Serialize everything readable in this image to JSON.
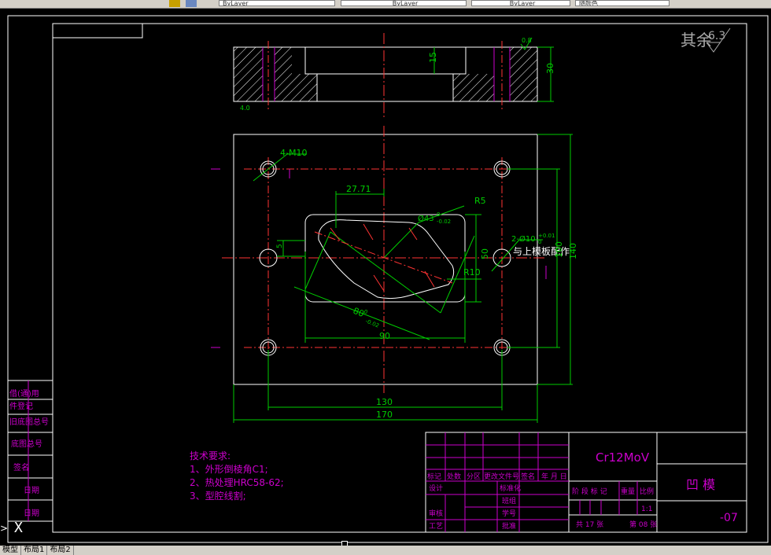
{
  "toolbar": {
    "layer_combo_1": "ByLayer",
    "layer_combo_2": "ByLayer",
    "layer_combo_3": "ByLayer",
    "plot_style": "随颜色"
  },
  "drawing": {
    "surface_finish_label": "其余",
    "surface_finish_value": "6.3",
    "top_finish": "0.8",
    "top_view_small_label": "4.0",
    "dim_15": "15",
    "dim_30": "30",
    "dim_4m10": "4-M10",
    "dim_27_71": "27.71",
    "dim_r5": "R5",
    "dim_phi43": "Ø43",
    "dim_phi43_tol": "-0.02",
    "dim_phi43_tol_up": "0",
    "dim_2phi10": "2-Ø10",
    "dim_2phi10_tol": "+0.01",
    "dim_2phi10_tol_low": "0",
    "note_match": "与上模板配作",
    "dim_5": "5",
    "dim_50": "50",
    "dim_r10": "R10",
    "dim_80": "80",
    "dim_80_tol": "-0.02",
    "dim_80_tol_up": "0",
    "dim_90": "90",
    "dim_100": "100",
    "dim_140": "140",
    "dim_130": "130",
    "dim_170": "170"
  },
  "tech_requirements": {
    "title": "技术要求:",
    "item1": "1、外形倒棱角C1;",
    "item2": "2、热处理HRC58-62;",
    "item3": "3、型腔线割;"
  },
  "side_table": {
    "r1": "借(通)用",
    "r2": "件登记",
    "r3": "旧底图总号",
    "r4": "底图总号",
    "r5": "签名",
    "r6": "日期",
    "r7": "日期"
  },
  "title_block": {
    "material": "Cr12MoV",
    "part_name": "凹  模",
    "drawing_no": "-07",
    "h_biaoji": "标记",
    "h_chushu": "处数",
    "h_fenqu": "分区",
    "h_gengai": "更改文件号",
    "h_qianming": "签名",
    "h_ymd": "年 月 日",
    "sheji": "设计",
    "biaozhunhua": "标准化",
    "shenhe": "审核",
    "gongyi": "工艺",
    "banzu": "班组",
    "xuehao": "学号",
    "pizhun": "批准",
    "stage_label": "阶 段 标 记",
    "weight": "重量",
    "scale_label": "比例",
    "scale_value": "1:1",
    "total_sheets": "共 17  张",
    "sheet_no": "第 08  张"
  },
  "layout_tabs": {
    "model": "模型",
    "layout1": "布局1",
    "layout2": "布局2"
  }
}
